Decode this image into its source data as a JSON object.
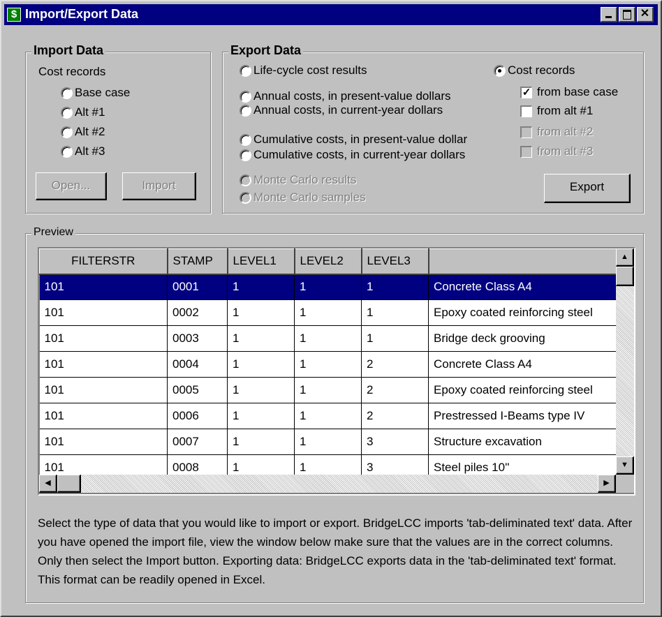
{
  "window": {
    "title": "Import/Export Data",
    "icon_glyph": "$",
    "icon_name": "dollar-app-icon",
    "close_glyph": "✕"
  },
  "import_data": {
    "group_title": "Import Data",
    "sub_label": "Cost records",
    "options": [
      {
        "label": "Base case",
        "selected": false
      },
      {
        "label": "Alt #1",
        "selected": false
      },
      {
        "label": "Alt #2",
        "selected": false
      },
      {
        "label": "Alt #3",
        "selected": false
      }
    ],
    "open_button": "Open...",
    "import_button": "Import"
  },
  "export_data": {
    "group_title": "Export Data",
    "options": [
      {
        "label": "Life-cycle cost results",
        "selected": false,
        "enabled": true
      },
      {
        "label": "Annual costs, in present-value dollars",
        "selected": false,
        "enabled": true
      },
      {
        "label": "Annual costs, in current-year dollars",
        "selected": false,
        "enabled": true
      },
      {
        "label": "Cumulative costs, in present-value dollar",
        "selected": false,
        "enabled": true
      },
      {
        "label": "Cumulative costs, in current-year dollars",
        "selected": false,
        "enabled": true
      },
      {
        "label": "Monte Carlo results",
        "selected": false,
        "enabled": false
      },
      {
        "label": "Monte Carlo samples",
        "selected": false,
        "enabled": false
      }
    ],
    "cost_records": {
      "label": "Cost records",
      "selected": true
    },
    "checkboxes": [
      {
        "label": "from base case",
        "checked": true,
        "enabled": true
      },
      {
        "label": "from alt #1",
        "checked": false,
        "enabled": true
      },
      {
        "label": "from alt #2",
        "checked": false,
        "enabled": false
      },
      {
        "label": "from alt #3",
        "checked": false,
        "enabled": false
      }
    ],
    "export_button": "Export"
  },
  "preview": {
    "group_title": "Preview",
    "columns": [
      "FILTERSTR",
      "STAMP",
      "LEVEL1",
      "LEVEL2",
      "LEVEL3",
      ""
    ],
    "rows": [
      {
        "filterstr": "101",
        "stamp": "0001",
        "level1": "1",
        "level2": "1",
        "level3": "1",
        "description": "Concrete Class A4",
        "selected": true
      },
      {
        "filterstr": "101",
        "stamp": "0002",
        "level1": "1",
        "level2": "1",
        "level3": "1",
        "description": "Epoxy coated reinforcing steel",
        "selected": false
      },
      {
        "filterstr": "101",
        "stamp": "0003",
        "level1": "1",
        "level2": "1",
        "level3": "1",
        "description": "Bridge deck grooving",
        "selected": false
      },
      {
        "filterstr": "101",
        "stamp": "0004",
        "level1": "1",
        "level2": "1",
        "level3": "2",
        "description": "Concrete Class A4",
        "selected": false
      },
      {
        "filterstr": "101",
        "stamp": "0005",
        "level1": "1",
        "level2": "1",
        "level3": "2",
        "description": "Epoxy coated reinforcing steel",
        "selected": false
      },
      {
        "filterstr": "101",
        "stamp": "0006",
        "level1": "1",
        "level2": "1",
        "level3": "2",
        "description": "Prestressed I-Beams type IV",
        "selected": false
      },
      {
        "filterstr": "101",
        "stamp": "0007",
        "level1": "1",
        "level2": "1",
        "level3": "3",
        "description": "Structure excavation",
        "selected": false
      },
      {
        "filterstr": "101",
        "stamp": "0008",
        "level1": "1",
        "level2": "1",
        "level3": "3",
        "description": "Steel piles 10''",
        "selected": false
      }
    ]
  },
  "help_text": "Select the type of data that you would like to import or export. BridgeLCC imports 'tab-deliminated text' data. After you have opened the import file,  view the window below make sure that the values are in the correct columns. Only then select the Import button. Exporting data: BridgeLCC exports data in the 'tab-deliminated text' format. This format can be readily opened in Excel."
}
